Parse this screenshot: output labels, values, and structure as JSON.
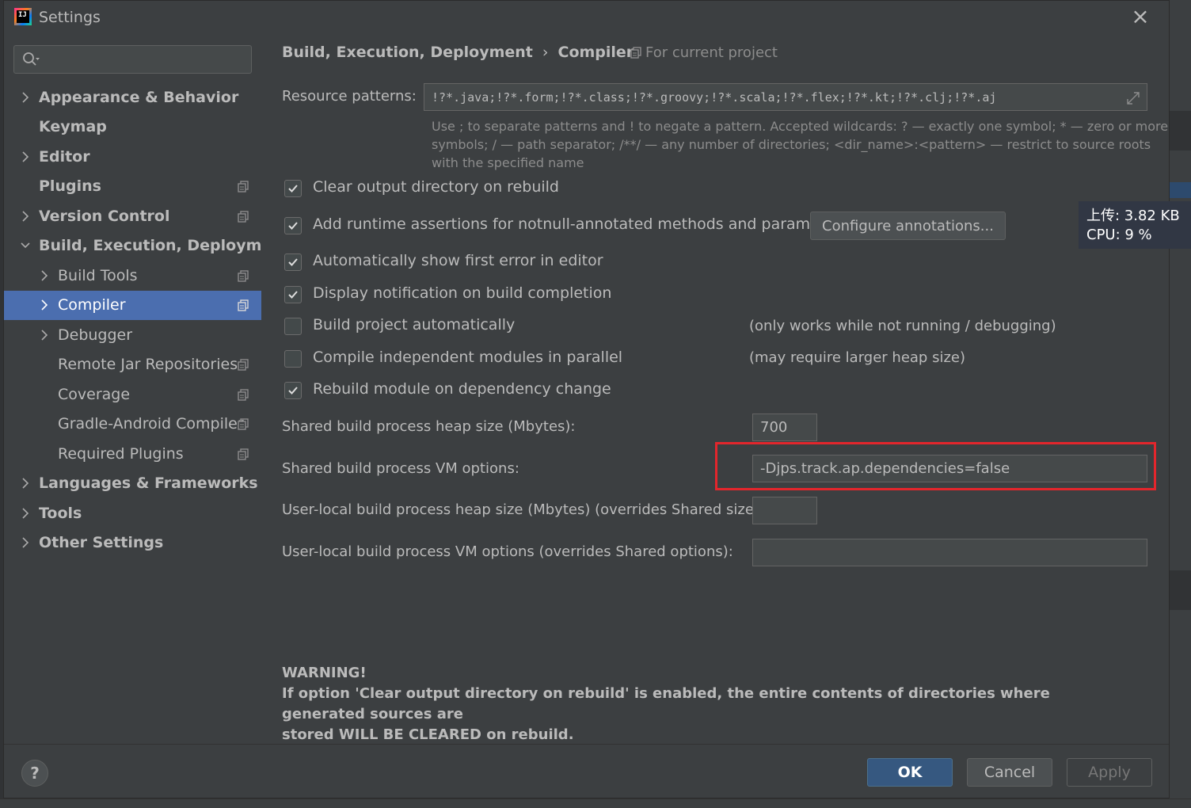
{
  "window": {
    "title": "Settings",
    "close_glyph": "×"
  },
  "sidebar": {
    "search": {
      "value": "",
      "placeholder": ""
    },
    "items": [
      {
        "label": "Appearance & Behavior",
        "level": 0,
        "bold": true,
        "expandable": true,
        "expanded": false,
        "project_icon": false
      },
      {
        "label": "Keymap",
        "level": 0,
        "bold": true,
        "expandable": false,
        "project_icon": false
      },
      {
        "label": "Editor",
        "level": 0,
        "bold": true,
        "expandable": true,
        "expanded": false,
        "project_icon": false
      },
      {
        "label": "Plugins",
        "level": 0,
        "bold": true,
        "expandable": false,
        "project_icon": true
      },
      {
        "label": "Version Control",
        "level": 0,
        "bold": true,
        "expandable": true,
        "expanded": false,
        "project_icon": true
      },
      {
        "label": "Build, Execution, Deployment",
        "level": 0,
        "bold": true,
        "expandable": true,
        "expanded": true,
        "project_icon": false
      },
      {
        "label": "Build Tools",
        "level": 1,
        "bold": false,
        "expandable": true,
        "expanded": false,
        "project_icon": true
      },
      {
        "label": "Compiler",
        "level": 1,
        "bold": false,
        "expandable": true,
        "expanded": false,
        "project_icon": true,
        "selected": true
      },
      {
        "label": "Debugger",
        "level": 1,
        "bold": false,
        "expandable": true,
        "expanded": false,
        "project_icon": false
      },
      {
        "label": "Remote Jar Repositories",
        "level": 1,
        "bold": false,
        "expandable": false,
        "project_icon": true
      },
      {
        "label": "Coverage",
        "level": 1,
        "bold": false,
        "expandable": false,
        "project_icon": true
      },
      {
        "label": "Gradle-Android Compiler",
        "level": 1,
        "bold": false,
        "expandable": false,
        "project_icon": true
      },
      {
        "label": "Required Plugins",
        "level": 1,
        "bold": false,
        "expandable": false,
        "project_icon": true
      },
      {
        "label": "Languages & Frameworks",
        "level": 0,
        "bold": true,
        "expandable": true,
        "expanded": false,
        "project_icon": false
      },
      {
        "label": "Tools",
        "level": 0,
        "bold": true,
        "expandable": true,
        "expanded": false,
        "project_icon": false
      },
      {
        "label": "Other Settings",
        "level": 0,
        "bold": true,
        "expandable": true,
        "expanded": false,
        "project_icon": false
      }
    ]
  },
  "main": {
    "breadcrumb": {
      "parent": "Build, Execution, Deployment",
      "separator": "›",
      "current": "Compiler"
    },
    "scope": "For current project",
    "resource_patterns": {
      "label": "Resource patterns:",
      "value": "!?*.java;!?*.form;!?*.class;!?*.groovy;!?*.scala;!?*.flex;!?*.kt;!?*.clj;!?*.aj",
      "hint_line1": "Use ; to separate patterns and ! to negate a pattern. Accepted wildcards: ? — exactly one symbol; * — zero or more",
      "hint_line2": "symbols; / — path separator; /**/ — any number of directories; <dir_name>:<pattern> — restrict to source roots",
      "hint_line3": "with the specified name"
    },
    "checkboxes": [
      {
        "label": "Clear output directory on rebuild",
        "checked": true
      },
      {
        "label": "Add runtime assertions for notnull-annotated methods and parameters",
        "checked": true
      },
      {
        "label": "Automatically show first error in editor",
        "checked": true
      },
      {
        "label": "Display notification on build completion",
        "checked": true
      },
      {
        "label": "Build project automatically",
        "checked": false
      },
      {
        "label": "Compile independent modules in parallel",
        "checked": false
      },
      {
        "label": "Rebuild module on dependency change",
        "checked": true
      }
    ],
    "configure_annotations_label": "Configure annotations...",
    "notes": {
      "build_auto": "(only works while not running / debugging)",
      "parallel": "(may require larger heap size)"
    },
    "shared_heap": {
      "label": "Shared build process heap size (Mbytes):",
      "value": "700"
    },
    "shared_vm": {
      "label": "Shared build process VM options:",
      "value": "-Djps.track.ap.dependencies=false"
    },
    "user_heap": {
      "label": "User-local build process heap size (Mbytes) (overrides Shared size):",
      "value": ""
    },
    "user_vm": {
      "label": "User-local build process VM options (overrides Shared options):",
      "value": ""
    },
    "warning": {
      "title": "WARNING!",
      "line1": "If option 'Clear output directory on rebuild' is enabled, the entire contents of directories where generated sources are",
      "line2": "stored WILL BE CLEARED on rebuild."
    }
  },
  "footer": {
    "help": "?",
    "ok": "OK",
    "cancel": "Cancel",
    "apply": "Apply"
  },
  "overlay": {
    "upload": "上传: 3.82 KB",
    "cpu": "CPU: 9 %"
  },
  "colors": {
    "accent": "#4b6eaf",
    "highlight": "#e3262c",
    "ok": "#365880",
    "background": "#3c3f41"
  },
  "icons": [
    "app-icon",
    "close-icon",
    "search-icon",
    "chevron-right-icon",
    "chevron-down-icon",
    "project-scope-icon",
    "checkbox-check-icon",
    "expand-icon",
    "help-icon"
  ]
}
